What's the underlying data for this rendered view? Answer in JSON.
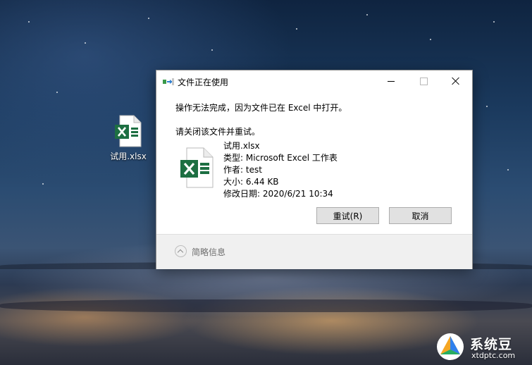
{
  "desktop": {
    "file_icon": "excel-file-icon",
    "file_label": "试用.xlsx"
  },
  "dialog": {
    "title": "文件正在使用",
    "title_icon": "file-transfer-icon",
    "controls": {
      "minimize": "minimize-icon",
      "maximize": "maximize-icon",
      "close": "close-icon"
    },
    "message": "操作无法完成，因为文件已在 Excel 中打开。",
    "instruction": "请关闭该文件并重试。",
    "file": {
      "icon": "excel-file-icon",
      "name": "试用.xlsx",
      "type": "类型: Microsoft Excel 工作表",
      "author": "作者: test",
      "size": "大小: 6.44 KB",
      "modified": "修改日期: 2020/6/21 10:34"
    },
    "buttons": {
      "retry": "重试(R)",
      "cancel": "取消"
    },
    "footer": {
      "label": "简略信息",
      "icon": "chevron-up-icon"
    }
  },
  "watermark": {
    "title": "系统豆",
    "url": "xtdptc.com"
  },
  "colors": {
    "excel_green": "#1d6f42",
    "dialog_bg": "#ffffff",
    "footer_bg": "#f0f0f0",
    "button_bg": "#e1e1e1"
  }
}
